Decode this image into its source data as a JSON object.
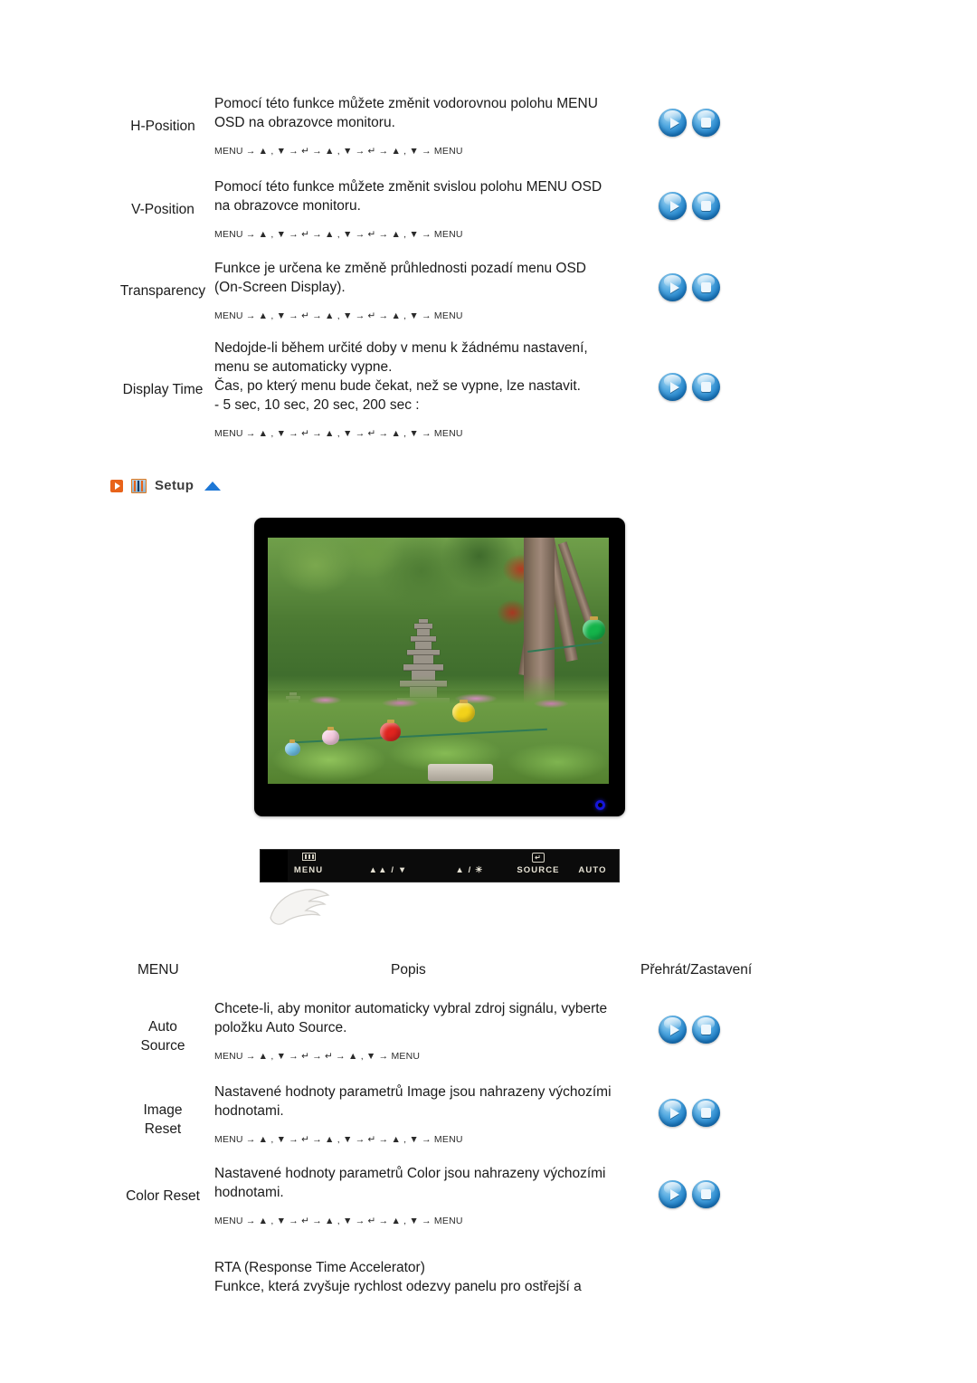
{
  "page": {
    "background": "#ffffff",
    "accent_orange": "#e8631a",
    "accent_blue": "#1d77d6"
  },
  "osd_table": {
    "rows": [
      {
        "label": "H-Position",
        "lines": [
          "Pomocí této funkce můžete změnit vodorovnou polohu MENU",
          "OSD na obrazovce monitoru."
        ],
        "keyseq": "MENU → ▲ , ▼ → ↵ → ▲ , ▼ → ↵ → ▲ , ▼ → MENU",
        "buttons": [
          "play",
          "stop"
        ]
      },
      {
        "label": "V-Position",
        "lines": [
          "Pomocí této funkce můžete změnit svislou polohu MENU OSD",
          "na obrazovce monitoru."
        ],
        "keyseq": "MENU → ▲ , ▼ → ↵ → ▲ , ▼ → ↵ → ▲ , ▼ → MENU",
        "buttons": [
          "play",
          "stop"
        ]
      },
      {
        "label": "Transparency",
        "lines": [
          "Funkce je určena ke změně průhlednosti pozadí menu OSD",
          "(On-Screen Display)."
        ],
        "keyseq": "MENU → ▲ , ▼ → ↵ → ▲ , ▼ → ↵ → ▲ , ▼ → MENU",
        "buttons": [
          "play",
          "stop"
        ]
      },
      {
        "label": "Display Time",
        "lines": [
          "Nedojde-li během určité doby v menu k žádnému nastavení,",
          "menu se automaticky vypne.",
          "Čas, po který menu bude čekat, než se vypne, lze nastavit.",
          "- 5 sec, 10 sec, 20 sec, 200 sec   :"
        ],
        "keyseq": "MENU → ▲ , ▼ → ↵ → ▲ , ▼ → ↵ → ▲ , ▼ → MENU",
        "buttons": [
          "play",
          "stop"
        ]
      }
    ]
  },
  "setup_section": {
    "title": "Setup",
    "play_icon": "play-box-icon",
    "sliders_icon": "sliders-icon",
    "collapse_icon": "up-triangle-icon"
  },
  "monitor": {
    "screen_alt": "garden scene with stone pagodas and colored paper lanterns",
    "power_led": "power-led-blue"
  },
  "control_bar": {
    "buttons": [
      {
        "label": "MENU",
        "glyph": "bars-icon"
      },
      {
        "label": "▲▲ / ▼",
        "glyph": ""
      },
      {
        "label": "▲ / ☀",
        "glyph": ""
      },
      {
        "label": "SOURCE",
        "glyph": "enter-icon"
      },
      {
        "label": "AUTO",
        "glyph": ""
      }
    ]
  },
  "setup_table": {
    "headers": {
      "menu": "MENU",
      "description": "Popis",
      "play_stop": "Přehrát/Zastavení"
    },
    "rows": [
      {
        "label_lines": [
          "Auto",
          "Source"
        ],
        "lines": [
          "Chcete-li, aby monitor automaticky vybral zdroj signálu, vyberte",
          "položku Auto Source."
        ],
        "keyseq": "MENU → ▲ , ▼ → ↵ → ↵ → ▲ , ▼ → MENU",
        "buttons": [
          "play",
          "stop"
        ]
      },
      {
        "label_lines": [
          "Image",
          "Reset"
        ],
        "lines": [
          "Nastavené hodnoty parametrů Image jsou nahrazeny výchozími",
          "hodnotami."
        ],
        "keyseq": "MENU → ▲ , ▼ → ↵ → ▲ , ▼ → ↵ → ▲ , ▼ → MENU",
        "buttons": [
          "play",
          "stop"
        ]
      },
      {
        "label_lines": [
          "Color Reset"
        ],
        "lines": [
          "Nastavené hodnoty parametrů Color jsou nahrazeny výchozími",
          "hodnotami."
        ],
        "keyseq": "MENU → ▲ , ▼ → ↵ → ▲ , ▼ → ↵ → ▲ , ▼ → MENU",
        "buttons": [
          "play",
          "stop"
        ]
      },
      {
        "label_lines": [],
        "lines": [
          "RTA (Response Time Accelerator)",
          "Funkce, která zvyšuje rychlost odezvy panelu pro ostřejší a"
        ],
        "keyseq": "",
        "buttons": []
      }
    ]
  }
}
